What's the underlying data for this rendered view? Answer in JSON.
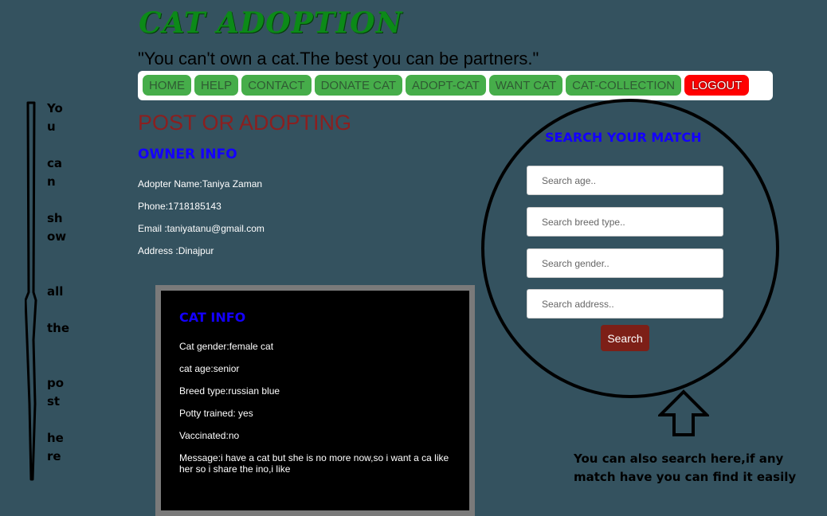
{
  "header": {
    "site_title": "CAT ADOPTION",
    "tagline": "\"You can't own a cat.The best you can be partners.\""
  },
  "nav": {
    "items": [
      "HOME",
      "HELP",
      "CONTACT",
      "DONATE CAT",
      "ADOPT-CAT",
      "WANT CAT",
      "CAT-COLLECTION"
    ],
    "logout": "LOGOUT"
  },
  "owner": {
    "section_title": "POST OR ADOPTING",
    "heading": "OWNER INFO",
    "name": "Adopter Name:Taniya Zaman",
    "phone": "Phone:1718185143",
    "email": "Email :taniyatanu@gmail.com",
    "address": "Address :Dinajpur"
  },
  "cat": {
    "heading": "CAT INFO",
    "gender": "Cat gender:female cat",
    "age": "cat age:senior",
    "breed": "Breed type:russian blue",
    "potty": "Potty trained: yes",
    "vaccinated": "Vaccinated:no",
    "message": "Message:i have a cat but she is no more now,so i want a ca like her so i share the ino,i like"
  },
  "search": {
    "heading": "SEARCH YOUR MATCH",
    "age_placeholder": "Search age..",
    "breed_placeholder": "Search breed type..",
    "gender_placeholder": "Search gender..",
    "address_placeholder": "Search address..",
    "button": "Search"
  },
  "annotations": {
    "side_words": [
      "Yo",
      "u",
      "ca",
      "n",
      "sh",
      "ow",
      "all",
      "the",
      "po",
      "st",
      "he",
      "re"
    ],
    "search_note_line1": "You can also search here,if any",
    "search_note_line2": "match have you can find it easily"
  },
  "colors": {
    "background": "#34525f",
    "nav_button": "#46ad4a",
    "logout": "#ff0000",
    "heading_blue": "#1400ff",
    "title_green": "#0c8a18",
    "search_button": "#7d1f17"
  }
}
